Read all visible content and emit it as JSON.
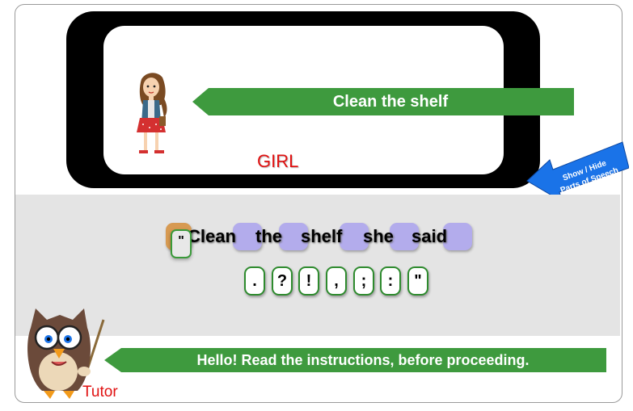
{
  "scene": {
    "speech_text": "Clean the shelf",
    "speaker_label": "GIRL",
    "pos_toggle_line1": "Show / Hide",
    "pos_toggle_line2": "Parts of Speech"
  },
  "sentence": {
    "open_quote": "\"",
    "words": [
      "Clean",
      "the",
      "shelf",
      "she",
      "said"
    ]
  },
  "punctuation": [
    ".",
    "?",
    "!",
    ",",
    ";",
    ":",
    "\""
  ],
  "tutor": {
    "label": "Tutor",
    "message": "Hello! Read the instructions, before proceeding."
  },
  "colors": {
    "banner_green": "#3e9a3e",
    "label_red": "#e01010",
    "tile_purple": "#b3acec",
    "tile_orange": "#d79a52",
    "toggle_blue": "#1a73e8"
  }
}
